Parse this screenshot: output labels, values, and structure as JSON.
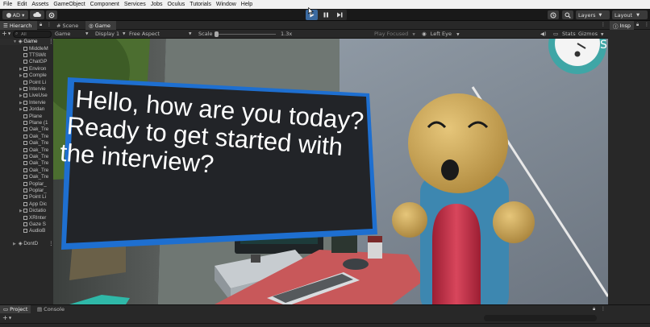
{
  "menubar": {
    "items": [
      "File",
      "Edit",
      "Assets",
      "GameObject",
      "Component",
      "Services",
      "Jobs",
      "Oculus",
      "Tutorials",
      "Window",
      "Help"
    ]
  },
  "toolbar": {
    "account": "AD ▾",
    "layers": "Layers",
    "layout": "Layout"
  },
  "hierarchy": {
    "tab_label": "Hierarch",
    "search_placeholder": "All",
    "root": "Game",
    "items": [
      {
        "label": "MiddleM",
        "arrow": false
      },
      {
        "label": "TTSWit",
        "arrow": false
      },
      {
        "label": "ChatGP",
        "arrow": false
      },
      {
        "label": "Environ",
        "arrow": true
      },
      {
        "label": "Comple",
        "arrow": true
      },
      {
        "label": "Point Li",
        "arrow": false
      },
      {
        "label": "Intervie",
        "arrow": true
      },
      {
        "label": "LiveUse",
        "arrow": true
      },
      {
        "label": "Intervie",
        "arrow": true
      },
      {
        "label": "Jordan",
        "arrow": true
      },
      {
        "label": "Plane",
        "arrow": false
      },
      {
        "label": "Plane (1",
        "arrow": false
      },
      {
        "label": "Oak_Tre",
        "arrow": false
      },
      {
        "label": "Oak_Tre",
        "arrow": false
      },
      {
        "label": "Oak_Tre",
        "arrow": false
      },
      {
        "label": "Oak_Tre",
        "arrow": false
      },
      {
        "label": "Oak_Tre",
        "arrow": false
      },
      {
        "label": "Oak_Tre",
        "arrow": false
      },
      {
        "label": "Oak_Tre",
        "arrow": false
      },
      {
        "label": "Oak_Tre",
        "arrow": false
      },
      {
        "label": "Poplar_",
        "arrow": false
      },
      {
        "label": "Poplar_",
        "arrow": false
      },
      {
        "label": "Point Li",
        "arrow": false
      },
      {
        "label": "App Dic",
        "arrow": false
      },
      {
        "label": "Dictatio",
        "arrow": true
      },
      {
        "label": "XRInter",
        "arrow": false
      },
      {
        "label": "Gaze S",
        "arrow": false
      },
      {
        "label": "AudioB",
        "arrow": false
      }
    ],
    "dontdestroy": "DontD"
  },
  "scene_tabs": {
    "scene": "Scene",
    "game": "Game"
  },
  "game_toolbar": {
    "mode": "Game",
    "display": "Display 1",
    "aspect": "Free Aspect",
    "scale_label": "Scale",
    "scale_value": "1.3x",
    "play_focused": "Play Focused",
    "eye": "Left Eye",
    "stats": "Stats",
    "gizmos": "Gizmos"
  },
  "inspector": {
    "tab_label": "Insp"
  },
  "speech": {
    "line1": "Hello, how are you today?",
    "line2": "Ready to get started with",
    "line3": "the interview?"
  },
  "bottom": {
    "project_tab": "Project",
    "console_tab": "Console"
  },
  "colors": {
    "accent": "#3b6aa0",
    "speech_border": "#1e6fd0",
    "speech_fill": "#222428",
    "avatar_skin": "#c9a55a",
    "avatar_body": "#3d87b0",
    "avatar_torso": "#c8324a",
    "desk": "#c8585a"
  }
}
